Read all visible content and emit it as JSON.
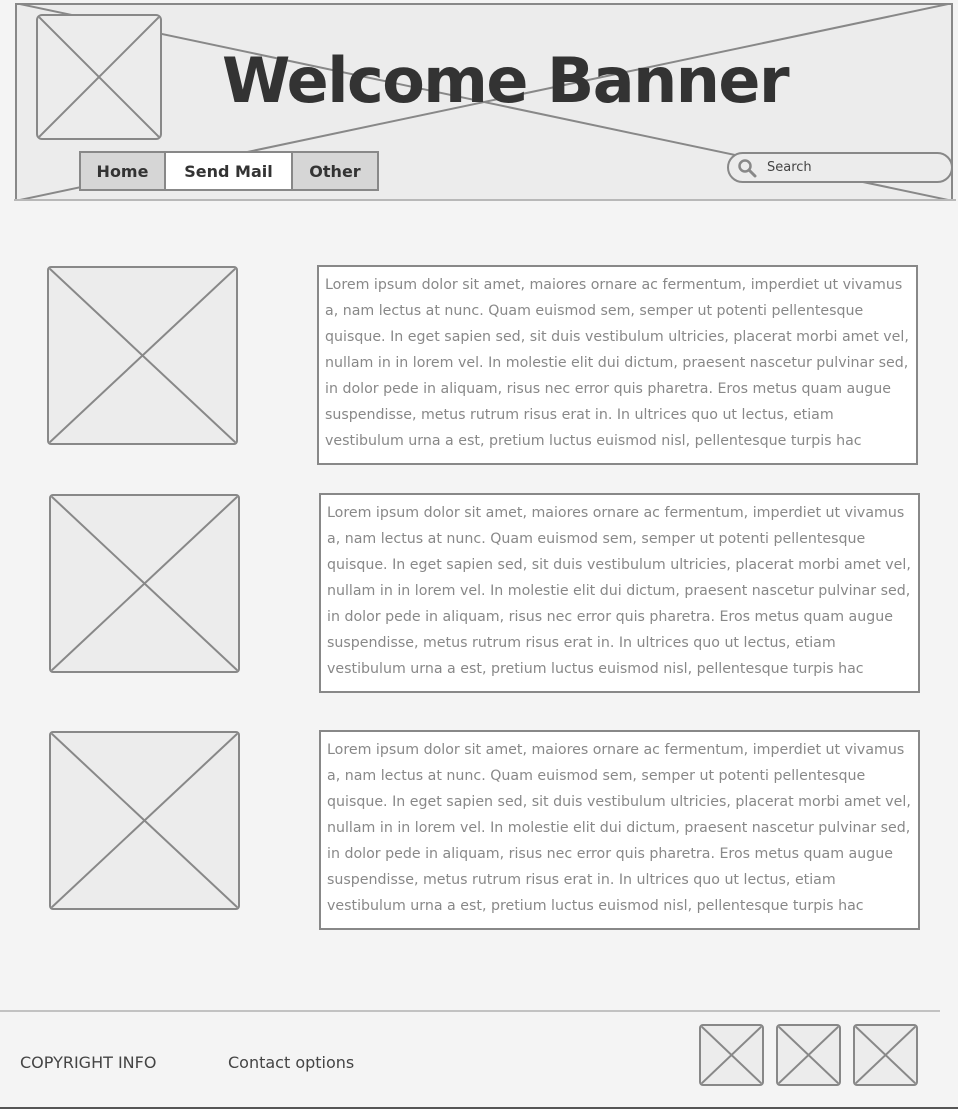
{
  "header": {
    "title": "Welcome Banner",
    "logo_icon": "image-placeholder-icon"
  },
  "nav": {
    "tabs": [
      {
        "label": "Home",
        "active": false
      },
      {
        "label": "Send Mail",
        "active": true
      },
      {
        "label": "Other",
        "active": false
      }
    ]
  },
  "search": {
    "placeholder": "Search",
    "icon": "search-icon"
  },
  "articles": [
    {
      "image_icon": "image-placeholder-icon",
      "text": "Lorem ipsum dolor sit amet, maiores ornare ac fermentum, imperdiet ut vivamus a, nam lectus at nunc. Quam euismod sem, semper ut potenti pellentesque quisque. In eget sapien sed, sit duis vestibulum ultricies, placerat morbi amet vel, nullam in in lorem vel. In molestie elit dui dictum, praesent nascetur pulvinar sed, in dolor pede in aliquam, risus nec error quis pharetra. Eros metus quam augue suspendisse, metus rutrum risus erat in.  In ultrices quo ut lectus, etiam vestibulum urna a est, pretium luctus euismod nisl, pellentesque turpis hac"
    },
    {
      "image_icon": "image-placeholder-icon",
      "text": "Lorem ipsum dolor sit amet, maiores ornare ac fermentum, imperdiet ut vivamus a, nam lectus at nunc. Quam euismod sem, semper ut potenti pellentesque quisque. In eget sapien sed, sit duis vestibulum ultricies, placerat morbi amet vel, nullam in in lorem vel. In molestie elit dui dictum, praesent nascetur pulvinar sed, in dolor pede in aliquam, risus nec error quis pharetra. Eros metus quam augue suspendisse, metus rutrum risus erat in.  In ultrices quo ut lectus, etiam vestibulum urna a est, pretium luctus euismod nisl, pellentesque turpis hac"
    },
    {
      "image_icon": "image-placeholder-icon",
      "text": "Lorem ipsum dolor sit amet, maiores ornare ac fermentum, imperdiet ut vivamus a, nam lectus at nunc. Quam euismod sem, semper ut potenti pellentesque quisque. In eget sapien sed, sit duis vestibulum ultricies, placerat morbi amet vel, nullam in in lorem vel. In molestie elit dui dictum, praesent nascetur pulvinar sed, in dolor pede in aliquam, risus nec error quis pharetra. Eros metus quam augue suspendisse, metus rutrum risus erat in.  In ultrices quo ut lectus, etiam vestibulum urna a est, pretium luctus euismod nisl, pellentesque turpis hac"
    }
  ],
  "footer": {
    "copyright": "COPYRIGHT INFO",
    "contact": "Contact options",
    "social_icons": [
      "image-placeholder-icon",
      "image-placeholder-icon",
      "image-placeholder-icon"
    ]
  },
  "colors": {
    "background": "#f4f4f4",
    "placeholder_fill": "#ececec",
    "stroke": "#888888",
    "text_dark": "#333333",
    "text_muted": "#888888"
  }
}
